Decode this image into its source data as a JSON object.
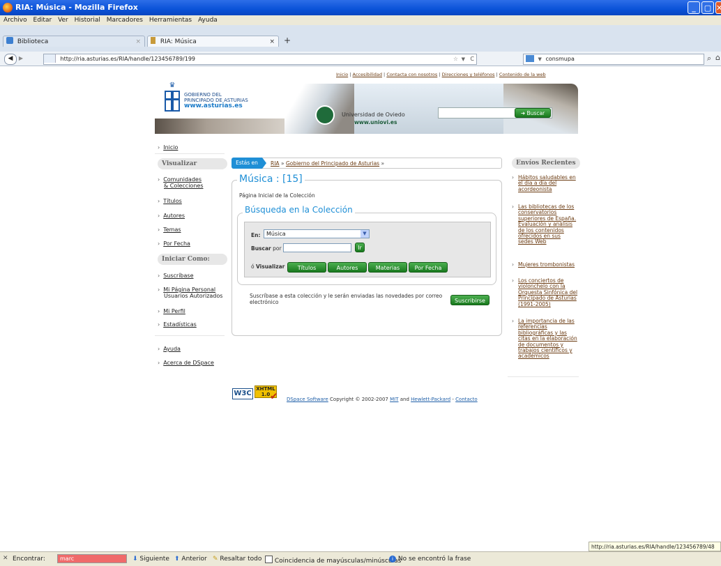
{
  "window": {
    "title": "RIA: Música - Mozilla Firefox"
  },
  "menu": [
    "Archivo",
    "Editar",
    "Ver",
    "Historial",
    "Marcadores",
    "Herramientas",
    "Ayuda"
  ],
  "tabs": [
    {
      "label": "Biblioteca"
    },
    {
      "label": "RIA: Música"
    }
  ],
  "address": {
    "url": "http://ria.asturias.es/RIA/handle/123456789/199"
  },
  "browser_search": {
    "value": "consmupa"
  },
  "header": {
    "links": [
      "Inicio",
      "Accesibilidad",
      "Contacta con nosotros",
      "Direcciones y teléfonos",
      "Contenido de la web"
    ],
    "gov_line1": "GOBIERNO DEL",
    "gov_line2": "PRINCIPADO DE ASTURIAS",
    "gov_url": "www.asturias.es",
    "uni_name": "Universidad de Oviedo",
    "uni_url": "www.uniovi.es",
    "search_button": "Buscar"
  },
  "sidebar": {
    "home": "Inicio",
    "visualizar_title": "Visualizar",
    "comunidades": "Comunidades",
    "colecciones": "& Colecciones",
    "browse": [
      "Títulos",
      "Autores",
      "Temas",
      "Por Fecha"
    ],
    "iniciar_title": "Iniciar Como:",
    "suscribase": "Suscríbase",
    "mi_pagina": "Mi Página Personal",
    "usuarios": "Usuarios Autorizados",
    "mi_perfil": "Mi Perfil",
    "estadisticas": "Estadísticas",
    "ayuda": "Ayuda",
    "acerca": "Acerca de DSpace"
  },
  "breadcrumb": {
    "label": "Estás en",
    "items": [
      "RIA",
      "Gobierno del Principado de Asturias"
    ]
  },
  "collection": {
    "title": "Música : [15]",
    "home_text": "Página Inicial de la Colección",
    "search_title": "Búsqueda en la Colección",
    "en_label": "En:",
    "en_value": "Música",
    "buscar_label": "Buscar",
    "por_label": "por",
    "ir": "Ir",
    "visualizar_prefix": "ó",
    "visualizar_label": "Visualizar",
    "browse_buttons": [
      "Títulos",
      "Autores",
      "Materias",
      "Por Fecha"
    ],
    "subscribe_text_1": "Suscríbase a esta colección y le serán enviadas las novedades por correo",
    "subscribe_text_2": "electrónico",
    "subscribe_button": "Suscribirse"
  },
  "recent": {
    "title": "Envíos Recientes",
    "items": [
      [
        "Hábitos saludables en",
        "el día a día del",
        "acordeonista"
      ],
      [
        "Las bibliotecas de los",
        "conservatorios",
        "superiores de España.",
        "Evaluación y análisis",
        "de los contenidos",
        "ofrecidos en sus",
        "sedes Web"
      ],
      [
        "Mujeres trombonistas"
      ],
      [
        "Los conciertos de",
        "violonchelo con la",
        "Orquesta Sinfónica del",
        "Principado de Asturias",
        "(1991-2005)"
      ],
      [
        "La importancia de las",
        "referencias",
        "bibliográficas y las",
        "citas en la elaboración",
        "de documentos y",
        "trabajos científicos y",
        "académicos"
      ]
    ]
  },
  "footer": {
    "badge_w3c": "W3C",
    "badge_xhtml": "XHTML",
    "badge_ver": "1.0",
    "dspace": "DSpace Software",
    "copyright": "Copyright © 2002-2007",
    "mit": "MIT",
    "and": "and",
    "hp": "Hewlett-Packard",
    "sep": "-",
    "contacto": "Contacto"
  },
  "status_url": "http://ria.asturias.es/RIA/handle/123456789/48",
  "findbar": {
    "label": "Encontrar:",
    "value": "marc",
    "next": "Siguiente",
    "prev": "Anterior",
    "highlight": "Resaltar todo",
    "match_case": "Coincidencia de mayúsculas/minúsculas",
    "not_found": "No se encontró la frase"
  },
  "colors": {
    "titlebar": "#0a52d8",
    "link": "#6a3a10",
    "accent_blue": "#1f8fd6",
    "green": "#2e8b32",
    "find_red": "#f06a6a"
  }
}
